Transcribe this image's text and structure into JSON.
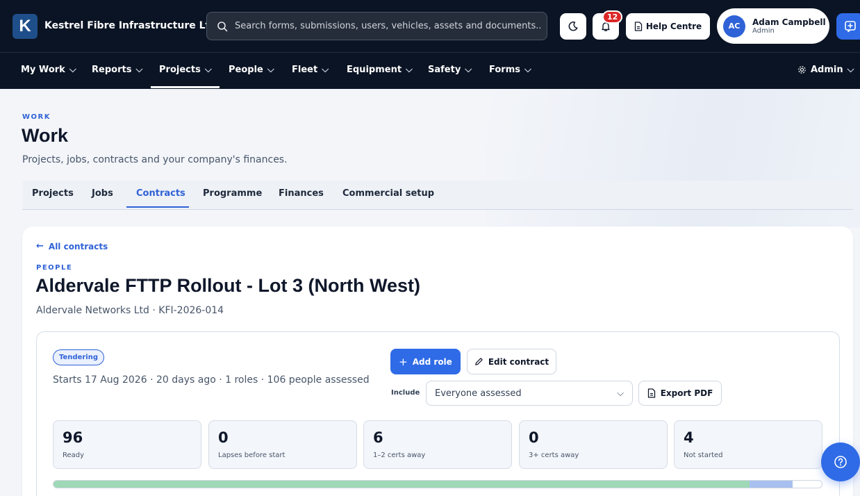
{
  "app": {
    "logo_letter": "K",
    "company": "Kestrel Fibre Infrastructure Ltd",
    "search_placeholder": "Search forms, submissions, users, vehicles, assets and documents..",
    "notifications_count": "12",
    "help_label": "Help Centre",
    "user": {
      "initials": "AC",
      "name": "Adam Campbell",
      "role": "Admin"
    },
    "brand_color": "#2f6be6",
    "icons": [
      "search-icon",
      "moon-icon",
      "bell-icon",
      "document-icon",
      "compose-icon",
      "gear-icon",
      "help-icon"
    ]
  },
  "nav": {
    "items": [
      {
        "label": "My Work"
      },
      {
        "label": "Reports"
      },
      {
        "label": "Projects",
        "active": true
      },
      {
        "label": "People"
      },
      {
        "label": "Fleet"
      },
      {
        "label": "Equipment"
      },
      {
        "label": "Safety"
      },
      {
        "label": "Forms"
      }
    ],
    "admin_label": "Admin"
  },
  "page": {
    "eyebrow": "WORK",
    "title": "Work",
    "subtitle": "Projects, jobs, contracts and your company's finances.",
    "tabs": [
      {
        "label": "Projects"
      },
      {
        "label": "Jobs"
      },
      {
        "label": "Contracts",
        "active": true
      },
      {
        "label": "Programme"
      },
      {
        "label": "Finances"
      },
      {
        "label": "Commercial setup"
      }
    ]
  },
  "contract": {
    "back_label": "All contracts",
    "section_label": "PEOPLE",
    "title": "Aldervale FTTP Rollout - Lot 3 (North West)",
    "client_line": "Aldervale Networks Ltd · KFI-2026-014",
    "status": "Tendering",
    "meta": "Starts 17 Aug 2026 · 20 days ago · 1 roles · 106 people assessed",
    "add_role_label": "Add role",
    "edit_label": "Edit contract",
    "include_label": "Include",
    "include_value": "Everyone assessed",
    "export_label": "Export PDF",
    "stats": [
      {
        "value": "96",
        "label": "Ready"
      },
      {
        "value": "0",
        "label": "Lapses before start"
      },
      {
        "value": "6",
        "label": "1–2 certs away"
      },
      {
        "value": "0",
        "label": "3+ certs away"
      },
      {
        "value": "4",
        "label": "Not started"
      }
    ],
    "progress": {
      "ready": 96,
      "near": 6,
      "far": 0,
      "not_started": 4,
      "total": 106
    },
    "colors": {
      "ready": "#9fd8b7",
      "near": "#a8c0ef",
      "status": "#2f62d6"
    }
  }
}
